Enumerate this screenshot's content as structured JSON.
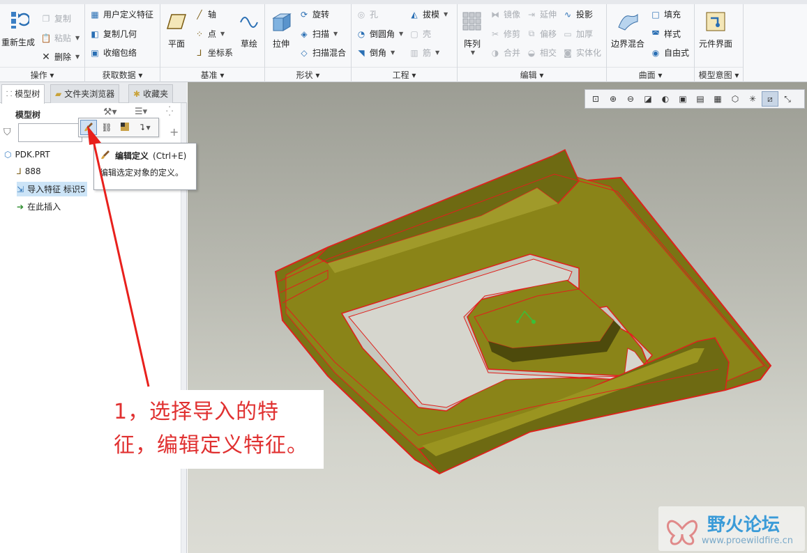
{
  "ribbon": {
    "groups": {
      "operations": "操作",
      "get_data": "获取数据",
      "datum": "基准",
      "shape": "形状",
      "engineering": "工程",
      "edit": "编辑",
      "surface": "曲面",
      "model_intent": "模型意图"
    },
    "operations": {
      "regenerate": "重新生成",
      "copy": "复制",
      "paste": "粘贴",
      "delete": "删除"
    },
    "get_data": {
      "user_defined_feature": "用户定义特征",
      "copy_geometry": "复制几何",
      "shrinkwrap": "收缩包络"
    },
    "datum": {
      "plane": "平面",
      "axis": "轴",
      "point": "点",
      "csys": "坐标系",
      "sketch": "草绘"
    },
    "shape": {
      "extrude": "拉伸",
      "revolve": "旋转",
      "sweep": "扫描",
      "swept_blend": "扫描混合"
    },
    "engineering": {
      "hole": "孔",
      "draft": "拔模",
      "round": "倒圆角",
      "shell": "壳",
      "chamfer": "倒角",
      "rib": "筋"
    },
    "edit": {
      "pattern": "阵列",
      "mirror": "镜像",
      "extend": "延伸",
      "project": "投影",
      "trim": "修剪",
      "offset": "偏移",
      "thicken": "加厚",
      "merge": "合并",
      "intersect": "相交",
      "solidify": "实体化"
    },
    "surface": {
      "boundary_blend": "边界混合",
      "fill": "填充",
      "style": "样式",
      "freestyle": "自由式"
    },
    "model_intent": {
      "component_interface": "元件界面"
    }
  },
  "left_panel": {
    "tabs": [
      "模型树",
      "文件夹浏览器",
      "收藏夹"
    ],
    "header": "模型树",
    "filter_value": "",
    "tree": {
      "root": "PDK.PRT",
      "csys": "888",
      "import_feature": "导入特征 标识5",
      "insert_here": "在此插入"
    }
  },
  "tooltip": {
    "title": "编辑定义",
    "shortcut": "(Ctrl+E)",
    "description": "编辑选定对象的定义。"
  },
  "annotation": {
    "line1": "1，选择导入的特",
    "line2": "征，编辑定义特征。",
    "color": "#e03030"
  },
  "watermark": {
    "name": "野火论坛",
    "url": "www.proewildfire.cn"
  },
  "colors": {
    "accent": "#2a6fb4",
    "model_body": "#7a7414",
    "model_edges": "#e0201c",
    "selected_row": "#cce4f7"
  }
}
